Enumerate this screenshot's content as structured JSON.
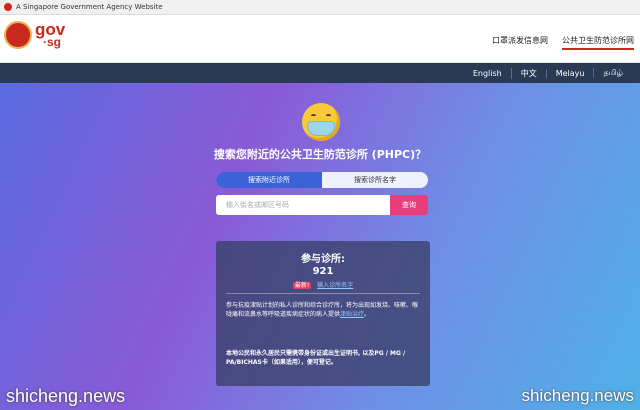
{
  "govbar": {
    "text": "A Singapore Government Agency Website"
  },
  "header": {
    "logo_line1": "gov",
    "logo_line2": "·sg",
    "links": [
      "口罩派发信息网",
      "公共卫生防范诊所网"
    ]
  },
  "langbar": {
    "languages": [
      "English",
      "中文",
      "Melayu",
      "தமிழ்"
    ]
  },
  "hero": {
    "title": "搜索您附近的公共卫生防范诊所 (PHPC)？",
    "tabs": [
      "搜索附近诊所",
      "搜索诊所名字"
    ],
    "search_placeholder": "输入街名或邮区号码",
    "search_button": "查询"
  },
  "panel": {
    "title": "参与诊所:",
    "count": "921",
    "badge": "最新!",
    "link": "输入诊所名字",
    "body1": "参与抗疫津贴计划的私人诊所和综合诊疗所，将为出现如发烧、咳嗽、喉咙痛和流鼻水等呼吸道疾病症状的病人提供",
    "body1_link": "津贴治疗",
    "body1_end": "。",
    "body2": "本地公民和永久居民只需携带身份证或出生证明书, 以及PG / MG / PA/BICHAS卡（如果适用），便可登记。"
  },
  "watermarks": [
    "shicheng.news",
    "shicheng.news"
  ],
  "colors": {
    "accent": "#c8281e",
    "search_button": "#e83e7c",
    "active_tab": "#3a63d8"
  }
}
